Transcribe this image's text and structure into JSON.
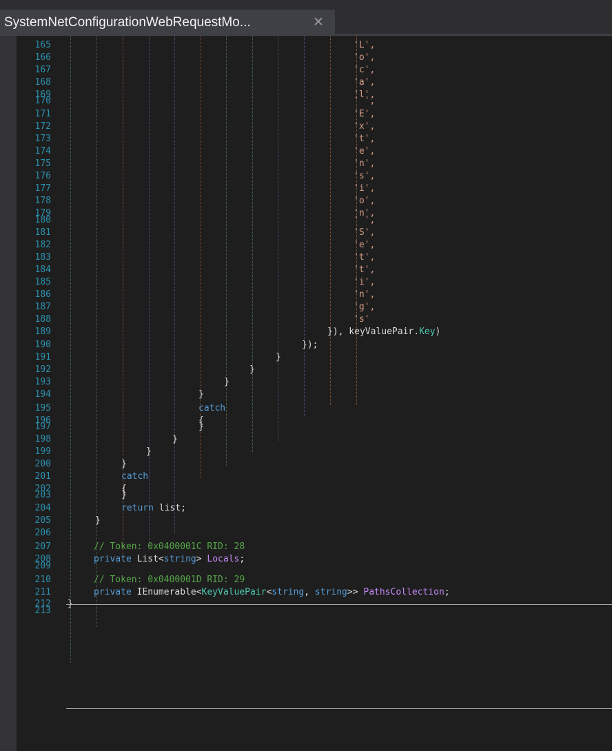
{
  "tab": {
    "title": "SystemNetConfigurationWebRequestMo...",
    "close_glyph": "✕"
  },
  "theme": {
    "background": "#1e1e1e",
    "line_number": "#2b91af",
    "keyword": "#569cd6",
    "string": "#d69d85",
    "comment": "#57a64a",
    "type": "#4ec9b0",
    "member": "#c58af9"
  },
  "lines": [
    {
      "n": "165",
      "t": [
        {
          "k": "str",
          "v": "'L',"
        }
      ]
    },
    {
      "n": "166",
      "t": [
        {
          "k": "str",
          "v": "'o',"
        }
      ]
    },
    {
      "n": "167",
      "t": [
        {
          "k": "str",
          "v": "'c',"
        }
      ]
    },
    {
      "n": "168",
      "t": [
        {
          "k": "str",
          "v": "'a',"
        }
      ]
    },
    {
      "n": "169",
      "t": [
        {
          "k": "str",
          "v": "'l',"
        }
      ]
    },
    {
      "n": "170",
      "t": [
        {
          "k": "str",
          "v": "' ',"
        }
      ]
    },
    {
      "n": "171",
      "t": [
        {
          "k": "str",
          "v": "'E',"
        }
      ]
    },
    {
      "n": "172",
      "t": [
        {
          "k": "str",
          "v": "'x',"
        }
      ]
    },
    {
      "n": "173",
      "t": [
        {
          "k": "str",
          "v": "'t',"
        }
      ]
    },
    {
      "n": "174",
      "t": [
        {
          "k": "str",
          "v": "'e',"
        }
      ]
    },
    {
      "n": "175",
      "t": [
        {
          "k": "str",
          "v": "'n',"
        }
      ]
    },
    {
      "n": "176",
      "t": [
        {
          "k": "str",
          "v": "'s',"
        }
      ]
    },
    {
      "n": "177",
      "t": [
        {
          "k": "str",
          "v": "'i',"
        }
      ]
    },
    {
      "n": "178",
      "t": [
        {
          "k": "str",
          "v": "'o',"
        }
      ]
    },
    {
      "n": "179",
      "t": [
        {
          "k": "str",
          "v": "'n',"
        }
      ]
    },
    {
      "n": "180",
      "t": [
        {
          "k": "str",
          "v": "' ',"
        }
      ]
    },
    {
      "n": "181",
      "t": [
        {
          "k": "str",
          "v": "'S',"
        }
      ]
    },
    {
      "n": "182",
      "t": [
        {
          "k": "str",
          "v": "'e',"
        }
      ]
    },
    {
      "n": "183",
      "t": [
        {
          "k": "str",
          "v": "'t',"
        }
      ]
    },
    {
      "n": "184",
      "t": [
        {
          "k": "str",
          "v": "'t',"
        }
      ]
    },
    {
      "n": "185",
      "t": [
        {
          "k": "str",
          "v": "'i',"
        }
      ]
    },
    {
      "n": "186",
      "t": [
        {
          "k": "str",
          "v": "'n',"
        }
      ]
    },
    {
      "n": "187",
      "t": [
        {
          "k": "str",
          "v": "'g',"
        }
      ]
    },
    {
      "n": "188",
      "t": [
        {
          "k": "str",
          "v": "'s'"
        }
      ]
    },
    {
      "n": "189",
      "t": [
        {
          "k": "plain",
          "v": "}), keyValuePair."
        },
        {
          "k": "type",
          "v": "Key"
        },
        {
          "k": "plain",
          "v": ")"
        }
      ]
    },
    {
      "n": "190",
      "t": [
        {
          "k": "plain",
          "v": "});"
        }
      ]
    },
    {
      "n": "191",
      "t": [
        {
          "k": "plain",
          "v": "}"
        }
      ]
    },
    {
      "n": "192",
      "t": [
        {
          "k": "plain",
          "v": "}"
        }
      ]
    },
    {
      "n": "193",
      "t": [
        {
          "k": "plain",
          "v": "}"
        }
      ]
    },
    {
      "n": "194",
      "t": [
        {
          "k": "plain",
          "v": "}"
        }
      ]
    },
    {
      "n": "195",
      "t": [
        {
          "k": "kw",
          "v": "catch"
        }
      ]
    },
    {
      "n": "196",
      "t": [
        {
          "k": "plain",
          "v": "{"
        }
      ]
    },
    {
      "n": "197",
      "t": [
        {
          "k": "plain",
          "v": "}"
        }
      ]
    },
    {
      "n": "198",
      "t": [
        {
          "k": "plain",
          "v": "}"
        }
      ]
    },
    {
      "n": "199",
      "t": [
        {
          "k": "plain",
          "v": "}"
        }
      ]
    },
    {
      "n": "200",
      "t": [
        {
          "k": "plain",
          "v": "}"
        }
      ]
    },
    {
      "n": "201",
      "t": [
        {
          "k": "kw",
          "v": "catch"
        }
      ]
    },
    {
      "n": "202",
      "t": [
        {
          "k": "plain",
          "v": "{"
        }
      ]
    },
    {
      "n": "203",
      "t": [
        {
          "k": "plain",
          "v": "}"
        }
      ]
    },
    {
      "n": "204",
      "t": [
        {
          "k": "kw",
          "v": "return"
        },
        {
          "k": "plain",
          "v": " list;"
        }
      ]
    },
    {
      "n": "205",
      "t": [
        {
          "k": "plain",
          "v": "}"
        }
      ]
    },
    {
      "n": "206",
      "t": []
    },
    {
      "n": "207",
      "t": [
        {
          "k": "com",
          "v": "// Token: 0x0400001C RID: 28"
        }
      ]
    },
    {
      "n": "208",
      "t": [
        {
          "k": "kw",
          "v": "private"
        },
        {
          "k": "plain",
          "v": " List<"
        },
        {
          "k": "kw",
          "v": "string"
        },
        {
          "k": "plain",
          "v": "> "
        },
        {
          "k": "prop",
          "v": "Locals"
        },
        {
          "k": "plain",
          "v": ";"
        }
      ]
    },
    {
      "n": "209",
      "t": []
    },
    {
      "n": "210",
      "t": [
        {
          "k": "com",
          "v": "// Token: 0x0400001D RID: 29"
        }
      ]
    },
    {
      "n": "211",
      "t": [
        {
          "k": "kw",
          "v": "private"
        },
        {
          "k": "plain",
          "v": " IEnumerable<"
        },
        {
          "k": "type",
          "v": "KeyValuePair"
        },
        {
          "k": "plain",
          "v": "<"
        },
        {
          "k": "kw",
          "v": "string"
        },
        {
          "k": "plain",
          "v": ", "
        },
        {
          "k": "kw",
          "v": "string"
        },
        {
          "k": "plain",
          "v": ">> "
        },
        {
          "k": "prop",
          "v": "PathsCollection"
        },
        {
          "k": "plain",
          "v": ";"
        }
      ]
    },
    {
      "n": "212",
      "t": [
        {
          "k": "plain",
          "v": "}"
        }
      ]
    },
    {
      "n": "213",
      "t": []
    }
  ]
}
